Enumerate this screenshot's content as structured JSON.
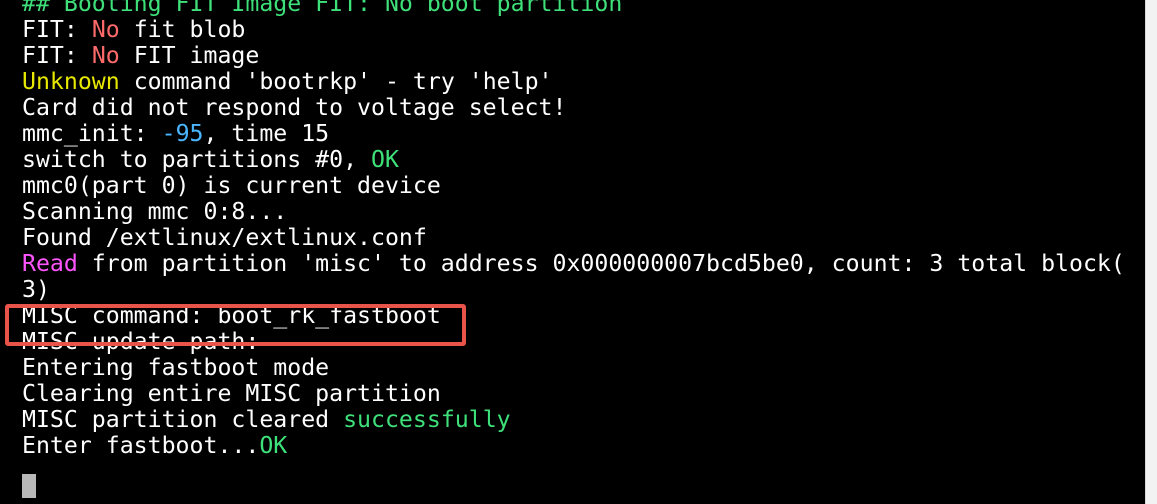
{
  "terminal": {
    "lines": [
      [
        {
          "t": "## Booting FIT Image FIT: No boot partition",
          "c": "c-green"
        }
      ],
      [
        {
          "t": "FIT: "
        },
        {
          "t": "No",
          "c": "c-red"
        },
        {
          "t": " fit blob"
        }
      ],
      [
        {
          "t": "FIT: "
        },
        {
          "t": "No",
          "c": "c-red"
        },
        {
          "t": " FIT image"
        }
      ],
      [
        {
          "t": "Unknown",
          "c": "c-yellow"
        },
        {
          "t": " command 'bootrkp' - try 'help'"
        }
      ],
      [
        {
          "t": "Card did not respond to voltage select!"
        }
      ],
      [
        {
          "t": "mmc_init: "
        },
        {
          "t": "-95",
          "c": "c-blue"
        },
        {
          "t": ", time 15"
        }
      ],
      [
        {
          "t": "switch to partitions #0, "
        },
        {
          "t": "OK",
          "c": "c-green"
        }
      ],
      [
        {
          "t": "mmc0(part 0) is current device"
        }
      ],
      [
        {
          "t": "Scanning mmc 0:8..."
        }
      ],
      [
        {
          "t": "Found /extlinux/extlinux.conf"
        }
      ],
      [
        {
          "t": "Read",
          "c": "c-magenta"
        },
        {
          "t": " from partition 'misc' to address 0x000000007bcd5be0, count: 3 total block("
        }
      ],
      [
        {
          "t": "3)"
        }
      ],
      [
        {
          "t": "MISC command: boot_rk_fastboot"
        }
      ],
      [
        {
          "t": "MISC update path:"
        }
      ],
      [
        {
          "t": "Entering fastboot mode"
        }
      ],
      [
        {
          "t": "Clearing entire MISC partition"
        }
      ],
      [
        {
          "t": "MISC partition cleared "
        },
        {
          "t": "successfully",
          "c": "c-green"
        }
      ],
      [
        {
          "t": "Enter fastboot..."
        },
        {
          "t": "OK",
          "c": "c-green"
        }
      ]
    ]
  },
  "colors": {
    "background": "#000000",
    "text": "#ffffff",
    "green": "#3ee07a",
    "red": "#ff6b6b",
    "yellow": "#e8e800",
    "blue": "#49b6ff",
    "magenta": "#ff55ff",
    "highlight": "#e8534a"
  }
}
